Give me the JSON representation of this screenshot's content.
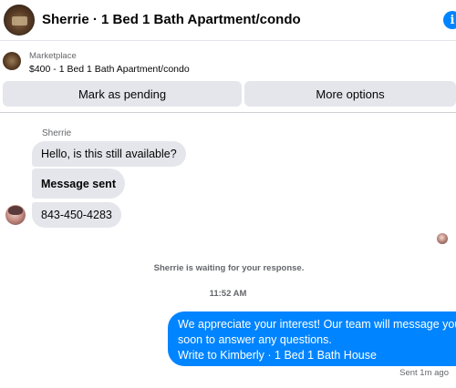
{
  "header": {
    "title": "Sherrie · 1 Bed 1 Bath Apartment/condo",
    "info_icon": "info-icon",
    "info_glyph": "i"
  },
  "listing": {
    "label": "Marketplace",
    "detail": "$400 - 1 Bed 1 Bath Apartment/condo"
  },
  "actions": {
    "pending_label": "Mark as pending",
    "more_label": "More options"
  },
  "conversation": {
    "sender_name": "Sherrie",
    "incoming": [
      "Hello, is this still available?",
      "Message sent",
      "843-450-4283"
    ],
    "waiting_text": "Sherrie is waiting for your response.",
    "timestamp": "11:52 AM",
    "outgoing_lines": [
      "We appreciate your interest! Our team will message you",
      " soon to answer any questions.",
      "Write to Kimberly · 1 Bed 1 Bath House"
    ],
    "sent_status": "Sent 1m ago"
  },
  "colors": {
    "accent": "#0084ff",
    "bubble_gray": "#e4e6eb",
    "muted_text": "#65676b"
  }
}
